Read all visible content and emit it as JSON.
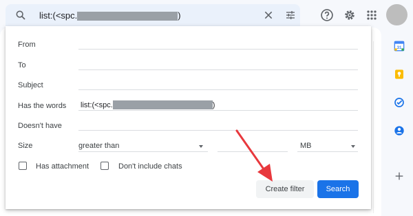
{
  "search": {
    "query_prefix": "list:(<spc.",
    "query_suffix": ")"
  },
  "filter": {
    "from_label": "From",
    "to_label": "To",
    "subject_label": "Subject",
    "has_words_label": "Has the words",
    "has_words_prefix": "list:(<spc.",
    "has_words_suffix": ")",
    "doesnt_have_label": "Doesn't have",
    "size_label": "Size",
    "size_operator": "greater than",
    "size_unit": "MB",
    "has_attachment_label": "Has attachment",
    "dont_include_chats_label": "Don't include chats",
    "create_filter_label": "Create filter",
    "search_label": "Search"
  },
  "colors": {
    "accent": "#1a73e8",
    "arrow": "#e8383d"
  },
  "icons": [
    "search-icon",
    "close-icon",
    "tune-icon",
    "help-icon",
    "settings-gear-icon",
    "apps-grid-icon",
    "calendar-icon",
    "keep-icon",
    "tasks-icon",
    "contacts-icon",
    "add-icon"
  ]
}
